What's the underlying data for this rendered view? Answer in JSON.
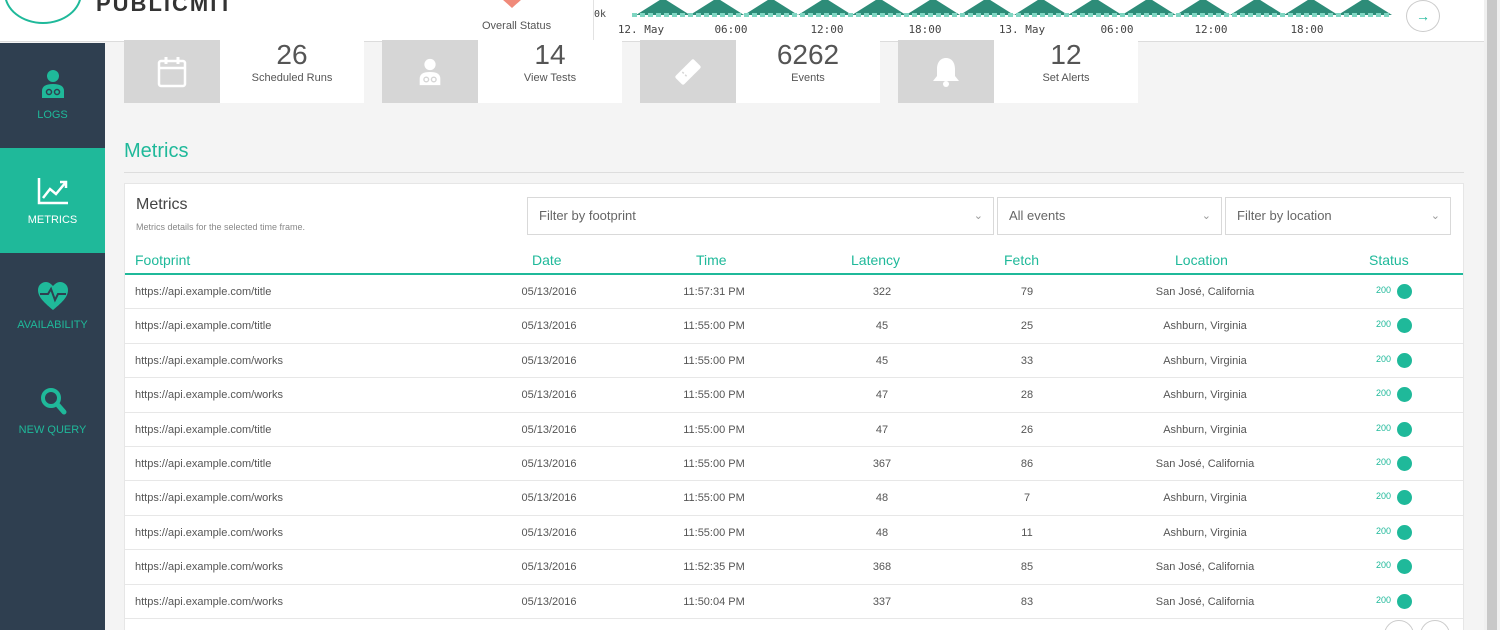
{
  "header": {
    "brand": "PUBLICMIT",
    "overall_status_label": "Overall Status",
    "chart_axis": {
      "y_label": "0k",
      "x_ticks": [
        "12. May",
        "06:00",
        "12:00",
        "18:00",
        "13. May",
        "06:00",
        "12:00",
        "18:00"
      ]
    },
    "next_icon": "arrow-right-icon"
  },
  "sidebar": {
    "items": [
      {
        "label": "LOGS",
        "icon": "doctor-icon",
        "active": false
      },
      {
        "label": "METRICS",
        "icon": "line-chart-icon",
        "active": true
      },
      {
        "label": "AVAILABILITY",
        "icon": "heartbeat-icon",
        "active": false
      },
      {
        "label": "NEW QUERY",
        "icon": "search-icon",
        "active": false
      }
    ]
  },
  "stats": [
    {
      "value": "26",
      "label": "Scheduled Runs",
      "icon": "calendar-icon"
    },
    {
      "value": "14",
      "label": "View Tests",
      "icon": "doctor-icon"
    },
    {
      "value": "6262",
      "label": "Events",
      "icon": "ticket-icon"
    },
    {
      "value": "12",
      "label": "Set Alerts",
      "icon": "bell-icon"
    }
  ],
  "section_title": "Metrics",
  "panel": {
    "title": "Metrics",
    "subtitle": "Metrics details for the selected time frame.",
    "filters": {
      "footprint": "Filter by footprint",
      "events": "All events",
      "location": "Filter by location"
    }
  },
  "table": {
    "columns": [
      "Footprint",
      "Date",
      "Time",
      "Latency",
      "Fetch",
      "Location",
      "Status"
    ],
    "rows": [
      {
        "footprint": "https://api.example.com/title",
        "date": "05/13/2016",
        "time": "11:57:31 PM",
        "latency": "322",
        "fetch": "79",
        "location": "San José, California",
        "status": "200"
      },
      {
        "footprint": "https://api.example.com/title",
        "date": "05/13/2016",
        "time": "11:55:00 PM",
        "latency": "45",
        "fetch": "25",
        "location": "Ashburn, Virginia",
        "status": "200"
      },
      {
        "footprint": "https://api.example.com/works",
        "date": "05/13/2016",
        "time": "11:55:00 PM",
        "latency": "45",
        "fetch": "33",
        "location": "Ashburn, Virginia",
        "status": "200"
      },
      {
        "footprint": "https://api.example.com/works",
        "date": "05/13/2016",
        "time": "11:55:00 PM",
        "latency": "47",
        "fetch": "28",
        "location": "Ashburn, Virginia",
        "status": "200"
      },
      {
        "footprint": "https://api.example.com/title",
        "date": "05/13/2016",
        "time": "11:55:00 PM",
        "latency": "47",
        "fetch": "26",
        "location": "Ashburn, Virginia",
        "status": "200"
      },
      {
        "footprint": "https://api.example.com/title",
        "date": "05/13/2016",
        "time": "11:55:00 PM",
        "latency": "367",
        "fetch": "86",
        "location": "San José, California",
        "status": "200"
      },
      {
        "footprint": "https://api.example.com/works",
        "date": "05/13/2016",
        "time": "11:55:00 PM",
        "latency": "48",
        "fetch": "7",
        "location": "Ashburn, Virginia",
        "status": "200"
      },
      {
        "footprint": "https://api.example.com/works",
        "date": "05/13/2016",
        "time": "11:55:00 PM",
        "latency": "48",
        "fetch": "11",
        "location": "Ashburn, Virginia",
        "status": "200"
      },
      {
        "footprint": "https://api.example.com/works",
        "date": "05/13/2016",
        "time": "11:52:35 PM",
        "latency": "368",
        "fetch": "85",
        "location": "San José, California",
        "status": "200"
      },
      {
        "footprint": "https://api.example.com/works",
        "date": "05/13/2016",
        "time": "11:50:04 PM",
        "latency": "337",
        "fetch": "83",
        "location": "San José, California",
        "status": "200"
      }
    ]
  },
  "colors": {
    "accent": "#1fb99a",
    "sidebar": "#2f3f50",
    "status_ok": "#1fb99a",
    "heart": "#f08a7a"
  }
}
